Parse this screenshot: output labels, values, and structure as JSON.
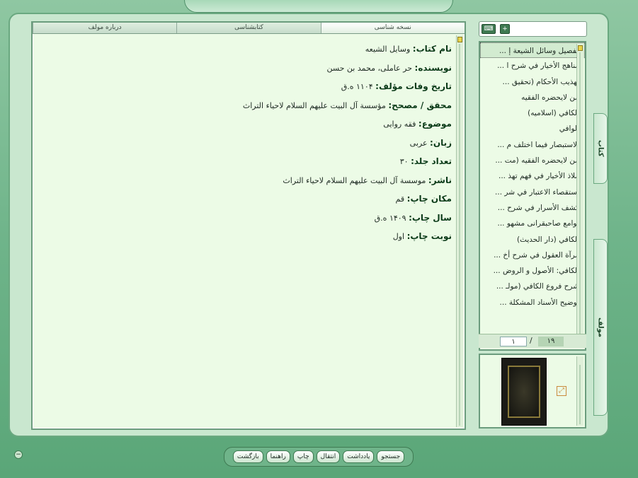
{
  "tabs": [
    "نسخه شناسی",
    "کتابشناسی",
    "درباره مولف"
  ],
  "info": [
    {
      "key": "نام کتاب:",
      "value": "وسایل الشیعه"
    },
    {
      "key": "نویسنده:",
      "value": "حر عاملی، محمد بن حسن"
    },
    {
      "key": "تاریخ وفات مؤلف:",
      "value": "۱۱۰۴ ه.ق"
    },
    {
      "key": "محقق / مصحح:",
      "value": "مؤسسة آل البیت علیهم السلام لاحیاء التراث"
    },
    {
      "key": "موضوع:",
      "value": "فقه روایی"
    },
    {
      "key": "زبان:",
      "value": "عربی"
    },
    {
      "key": "تعداد جلد:",
      "value": "۳۰"
    },
    {
      "key": "ناشر:",
      "value": "موسسة آل البیت علیهم السلام لاحیاء التراث"
    },
    {
      "key": "مکان چاپ:",
      "value": "قم"
    },
    {
      "key": "سال چاپ:",
      "value": "۱۴۰۹ ه.ق"
    },
    {
      "key": "نوبت چاپ:",
      "value": "اول"
    }
  ],
  "books": [
    "تفصيل وسائل الشيعة إ ...",
    "مناهج الأخيار في شرح ا ...",
    "تهذيب الأحكام (تحقيق ...",
    "من لايحضره الفقيه",
    "الكافي (اسلاميه)",
    "الوافي",
    "الاستبصار فيما اختلف م ...",
    "من لايحضره الفقيه (مت ...",
    "ملاذ الأخيار في فهم تهذ ...",
    "استقصاء الاعتبار في شر ...",
    "كشف الأسرار في شرح ...",
    "لوامع صاحبقرانى مشهو ...",
    "الكافي (دار الحديث)",
    "مرآة العقول في شرح أخ ...",
    "الكافي: الأصول و الروض ...",
    "شرح فروع الكافي (مولـ ...",
    "توضيح الأسناد المشكلة ..."
  ],
  "pager": {
    "total": "۱۹",
    "separator": "/",
    "current": "۱"
  },
  "side_tabs": {
    "books": "کتاب",
    "author": "مولف"
  },
  "buttons": [
    "جستجو",
    "یادداشت",
    "انتقال",
    "چاپ",
    "راهنما",
    "بازگشت"
  ],
  "icons": {
    "keyboard": "keyboard-icon",
    "search_go": "plus-icon",
    "expand": "expand-icon",
    "minimize": "minus-icon"
  },
  "colors": {
    "panel_bg": "#ecfbe6",
    "frame": "#6aa880",
    "accent_thumb": "#e8d44a"
  }
}
